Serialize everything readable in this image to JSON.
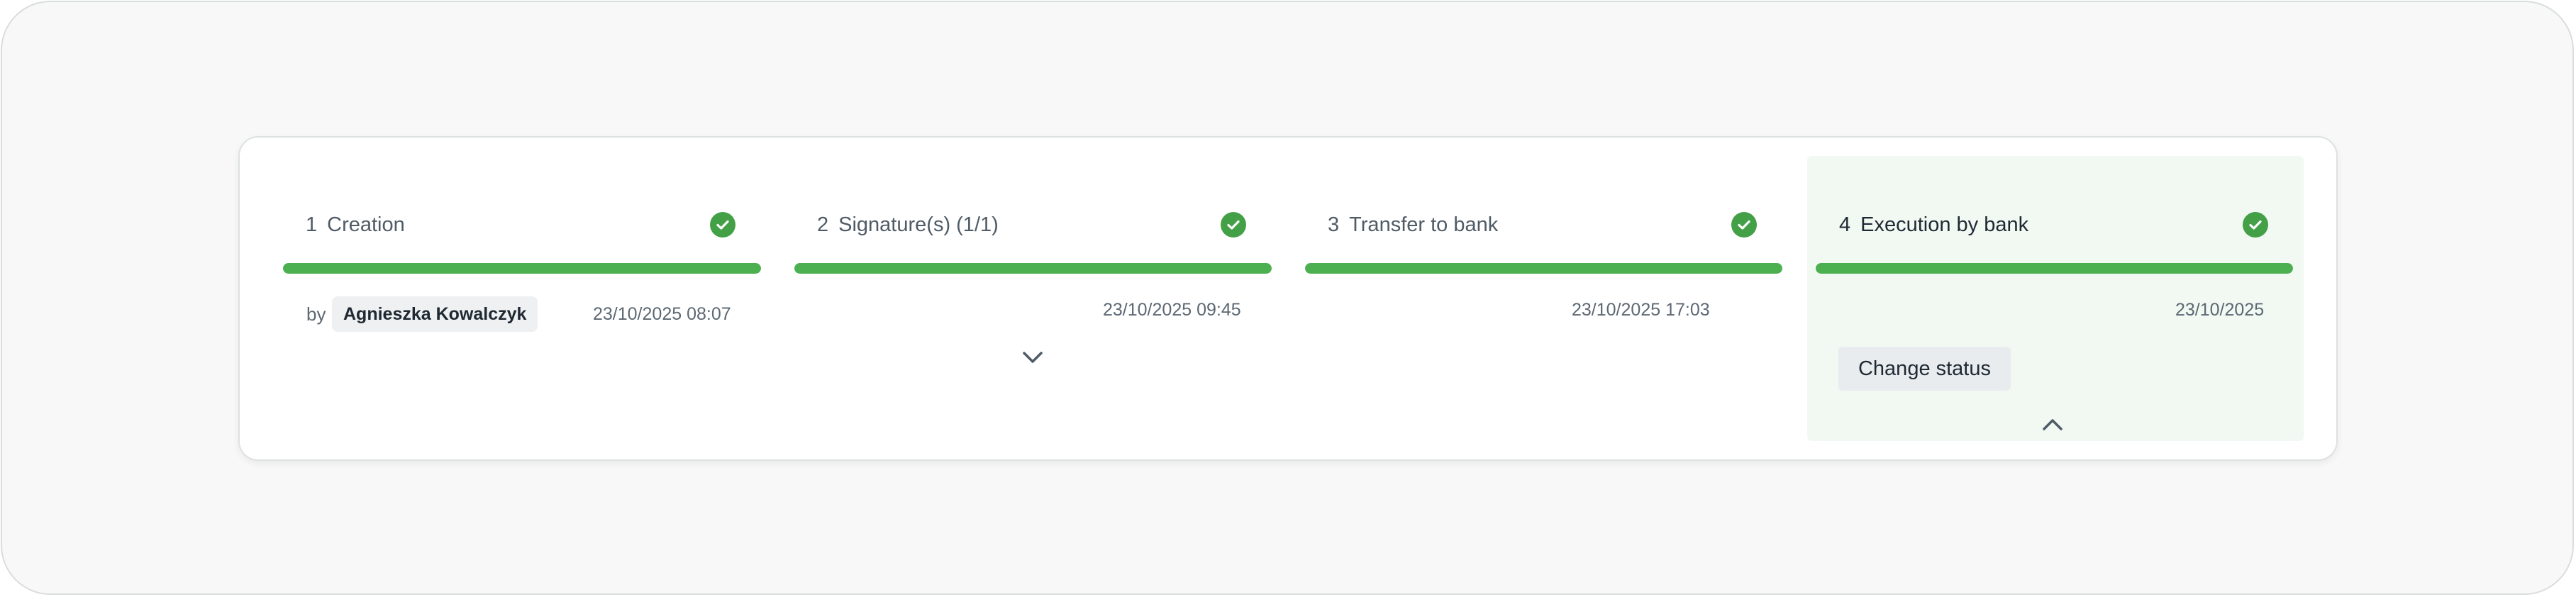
{
  "steps": [
    {
      "number": "1",
      "label": "Creation",
      "progress": 1.0,
      "completed": true,
      "by_label": "by",
      "user": "Agnieszka Kowalczyk",
      "timestamp": "23/10/2025 08:07"
    },
    {
      "number": "2",
      "label": "Signature(s) (1/1)",
      "progress": 1.0,
      "completed": true,
      "timestamp": "23/10/2025 09:45",
      "expand_icon": "chevron-down-icon"
    },
    {
      "number": "3",
      "label": "Transfer to bank",
      "progress": 1.0,
      "completed": true,
      "timestamp": "23/10/2025 17:03"
    },
    {
      "number": "4",
      "label": "Execution by bank",
      "progress": 1.0,
      "completed": true,
      "active": true,
      "timestamp": "23/10/2025",
      "action_label": "Change status",
      "collapse_icon": "chevron-up-icon"
    }
  ],
  "colors": {
    "success": "#43a047",
    "progress": "#4caf50",
    "active_background": "#f2f8f2",
    "text_primary": "#1f2933",
    "text_secondary": "#5c6873"
  },
  "icons": {
    "status": "check-circle-icon"
  }
}
